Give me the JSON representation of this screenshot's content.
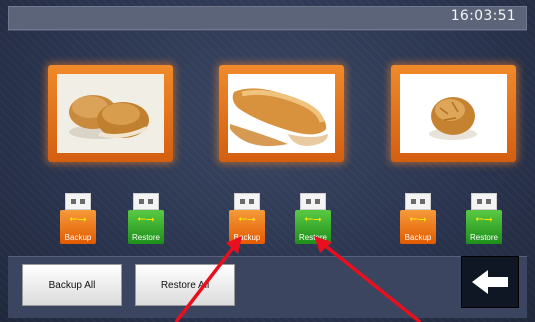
{
  "header": {
    "time": "16:03:51"
  },
  "products": [
    {
      "image": "two-round-buns",
      "backup_label": "Backup",
      "restore_label": "Restore"
    },
    {
      "image": "baguette-rolls",
      "backup_label": "Backup",
      "restore_label": "Restore"
    },
    {
      "image": "single-crusty-roll",
      "backup_label": "Backup",
      "restore_label": "Restore"
    }
  ],
  "footer": {
    "backup_all_label": "Backup All",
    "restore_all_label": "Restore All",
    "back_icon": "left-arrow-icon"
  },
  "colors": {
    "photo_frame": "#f08a2a",
    "backup_usb": "#e35a00",
    "restore_usb": "#1e8f1a",
    "annotation_arrow": "#e8101e"
  }
}
